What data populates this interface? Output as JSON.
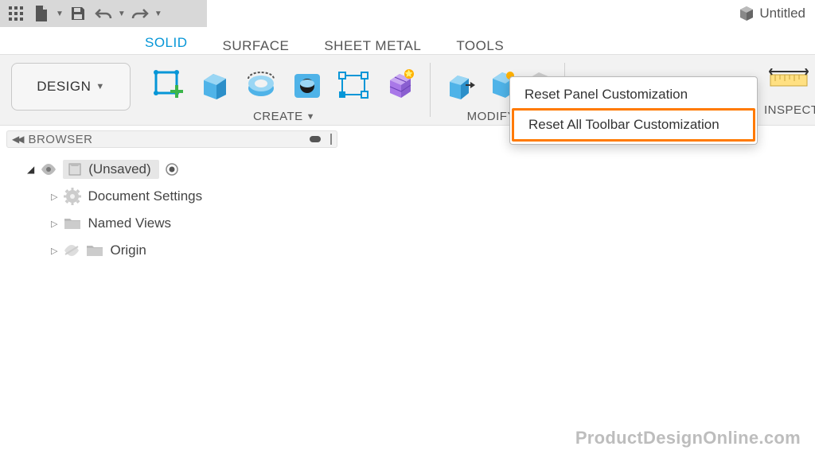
{
  "titlebar": {
    "doc_name": "Untitled"
  },
  "tabs": {
    "solid": "SOLID",
    "surface": "SURFACE",
    "sheetmetal": "SHEET METAL",
    "tools": "TOOLS"
  },
  "design_dropdown": "DESIGN",
  "panels": {
    "create": "CREATE",
    "modify": "MODIFY",
    "inspect": "INSPECT"
  },
  "context_menu": {
    "reset_panel": "Reset Panel Customization",
    "reset_all": "Reset All Toolbar Customization"
  },
  "browser": {
    "title": "BROWSER"
  },
  "tree": {
    "root": "(Unsaved)",
    "doc_settings": "Document Settings",
    "named_views": "Named Views",
    "origin": "Origin"
  },
  "watermark": "ProductDesignOnline.com"
}
